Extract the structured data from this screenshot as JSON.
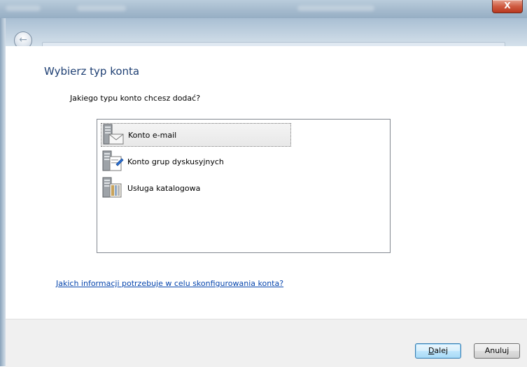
{
  "window": {
    "close_glyph": "X"
  },
  "navigation": {
    "back_glyph": "←"
  },
  "page": {
    "title": "Wybierz typ konta",
    "question": "Jakiego typu konto chcesz dodać?"
  },
  "account_types": {
    "items": [
      {
        "label": "Konto e-mail",
        "icon": "email-server-icon",
        "selected": true
      },
      {
        "label": "Konto grup dyskusyjnych",
        "icon": "newsgroup-server-icon",
        "selected": false
      },
      {
        "label": "Usługa katalogowa",
        "icon": "directory-service-icon",
        "selected": false
      }
    ]
  },
  "help_link": {
    "text": "Jakich informacji potrzebuje w celu skonfigurowania konta?"
  },
  "buttons": {
    "next_accel": "D",
    "next_rest": "alej",
    "cancel": "Anuluj"
  },
  "colors": {
    "title_blue": "#1e3f73",
    "link_blue": "#0645ad",
    "close_red": "#cf5c42"
  }
}
